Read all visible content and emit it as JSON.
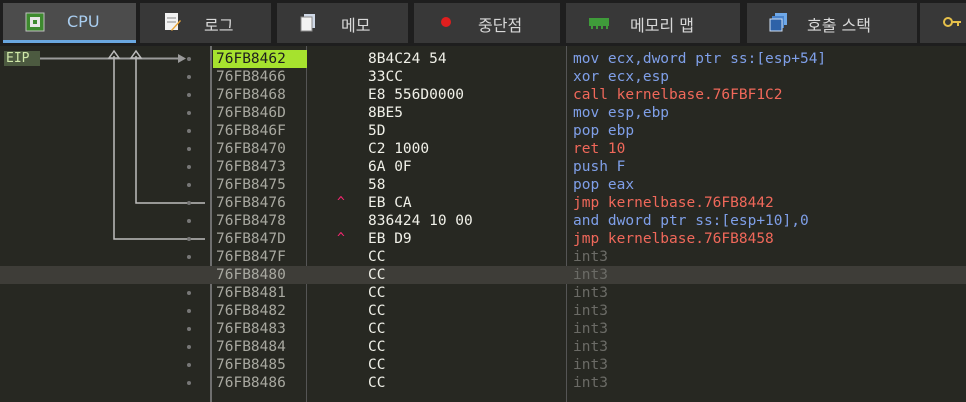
{
  "tabs": [
    {
      "label": "CPU",
      "icon": "cpu-icon",
      "active": true
    },
    {
      "label": "로그",
      "icon": "log-icon",
      "active": false
    },
    {
      "label": "메모",
      "icon": "notes-icon",
      "active": false
    },
    {
      "label": "중단점",
      "icon": "breakpoint-icon",
      "active": false
    },
    {
      "label": "메모리 맵",
      "icon": "memory-map-icon",
      "active": false
    },
    {
      "label": "호출 스택",
      "icon": "call-stack-icon",
      "active": false
    },
    {
      "label": "",
      "icon": "key-icon",
      "active": false
    }
  ],
  "eip_label": "EIP",
  "rows": [
    {
      "addr": "76FB8462",
      "bytes": "8B4C24 54",
      "asm": "mov ecx,dword ptr ss:[esp+54]",
      "mnem": "mov"
    },
    {
      "addr": "76FB8466",
      "bytes": "33CC",
      "asm": "xor ecx,esp",
      "mnem": "xor"
    },
    {
      "addr": "76FB8468",
      "bytes": "E8 556D0000",
      "asm": "call kernelbase.76FBF1C2",
      "mnem": "call"
    },
    {
      "addr": "76FB846D",
      "bytes": "8BE5",
      "asm": "mov esp,ebp",
      "mnem": "mov"
    },
    {
      "addr": "76FB846F",
      "bytes": "5D",
      "asm": "pop ebp",
      "mnem": "pop"
    },
    {
      "addr": "76FB8470",
      "bytes": "C2 1000",
      "asm": "ret 10",
      "mnem": "ret"
    },
    {
      "addr": "76FB8473",
      "bytes": "6A 0F",
      "asm": "push F",
      "mnem": "push"
    },
    {
      "addr": "76FB8475",
      "bytes": "58",
      "asm": "pop eax",
      "mnem": "pop"
    },
    {
      "addr": "76FB8476",
      "bytes": "EB CA",
      "asm": "jmp kernelbase.76FB8442",
      "mnem": "jmp",
      "jump_mark": "^"
    },
    {
      "addr": "76FB8478",
      "bytes": "836424 10 00",
      "asm": "and dword ptr ss:[esp+10],0",
      "mnem": "and"
    },
    {
      "addr": "76FB847D",
      "bytes": "EB D9",
      "asm": "jmp kernelbase.76FB8458",
      "mnem": "jmp",
      "jump_mark": "^"
    },
    {
      "addr": "76FB847F",
      "bytes": "CC",
      "asm": "int3",
      "mnem": "int3"
    },
    {
      "addr": "76FB8480",
      "bytes": "CC",
      "asm": "int3",
      "mnem": "int3"
    },
    {
      "addr": "76FB8481",
      "bytes": "CC",
      "asm": "int3",
      "mnem": "int3"
    },
    {
      "addr": "76FB8482",
      "bytes": "CC",
      "asm": "int3",
      "mnem": "int3"
    },
    {
      "addr": "76FB8483",
      "bytes": "CC",
      "asm": "int3",
      "mnem": "int3"
    },
    {
      "addr": "76FB8484",
      "bytes": "CC",
      "asm": "int3",
      "mnem": "int3"
    },
    {
      "addr": "76FB8485",
      "bytes": "CC",
      "asm": "int3",
      "mnem": "int3"
    },
    {
      "addr": "76FB8486",
      "bytes": "CC",
      "asm": "int3",
      "mnem": "int3"
    }
  ],
  "current_row": 0,
  "highlighted_row": 12,
  "colors": {
    "accent": "#a6e22e",
    "background": "#272822",
    "branch": "#f0685a",
    "mnemonic": "#7f9fe8"
  }
}
